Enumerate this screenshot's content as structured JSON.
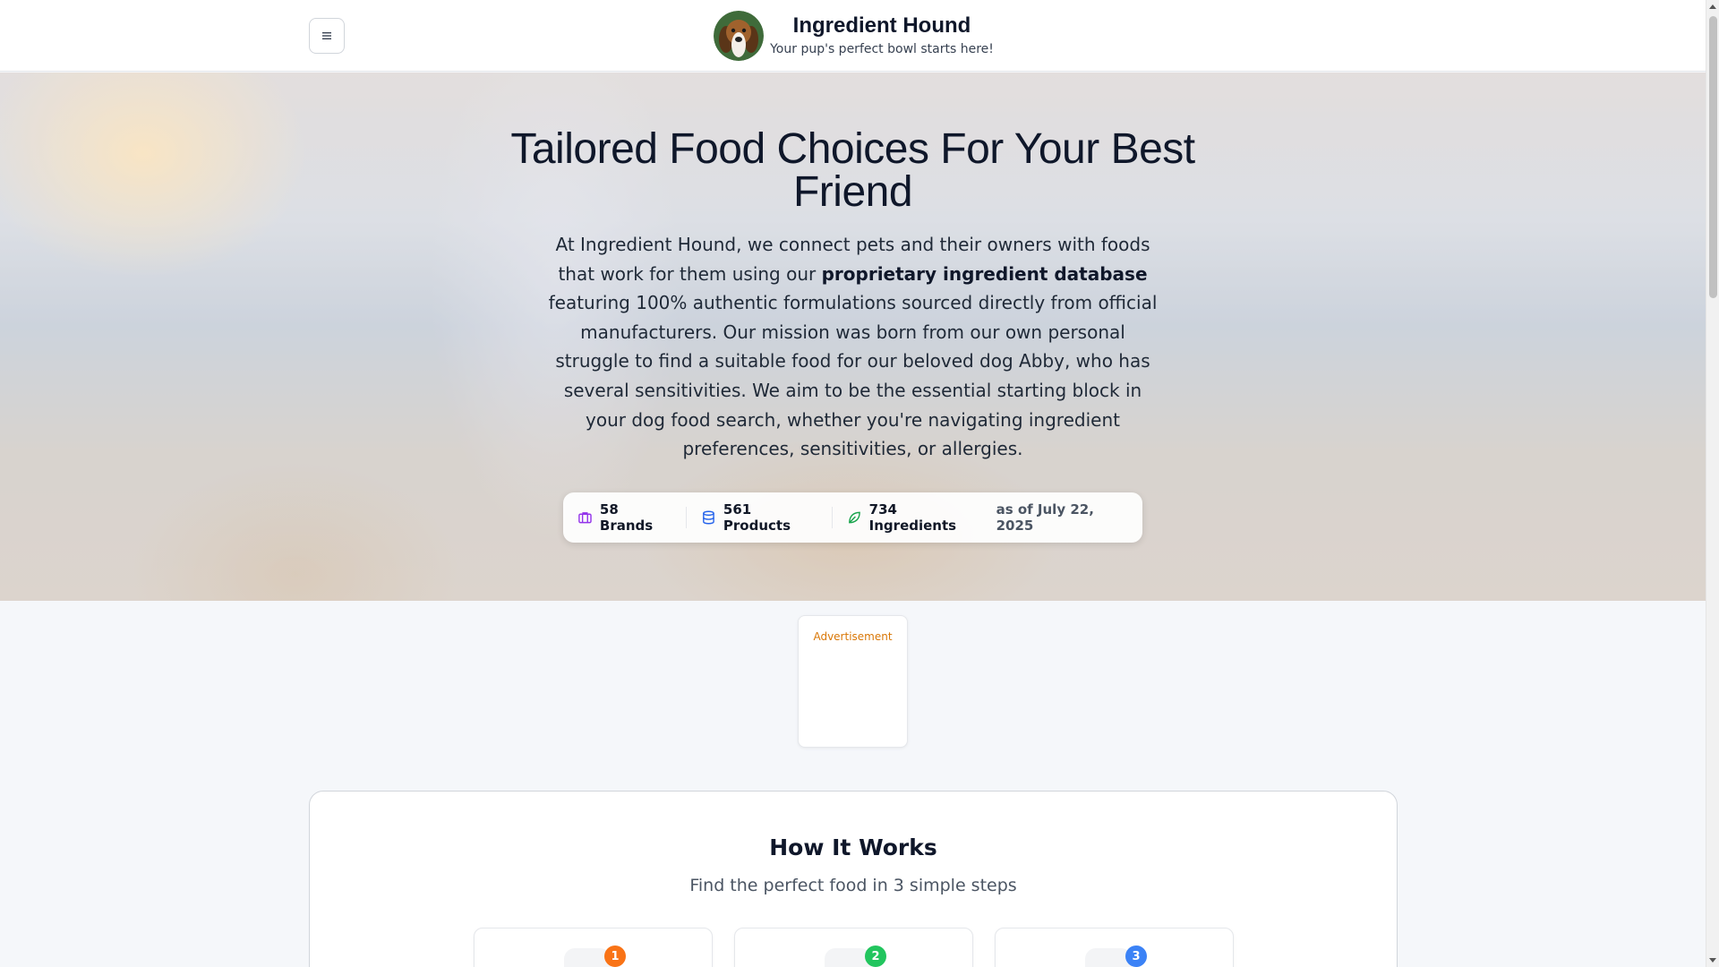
{
  "header": {
    "menu_icon": "hamburger-icon",
    "logo_icon": "beagle-dog-logo",
    "title": "Ingredient Hound",
    "tagline": "Your pup's perfect bowl starts here!"
  },
  "hero": {
    "title": "Tailored Food Choices For Your Best Friend",
    "desc_before": "At Ingredient Hound, we connect pets and their owners with foods that work for them using our ",
    "desc_bold": "proprietary ingredient database",
    "desc_after": " featuring 100% authentic formulations sourced directly from official manufacturers. Our mission was born from our own personal struggle to find a suitable food for our beloved dog Abby, who has several sensitivities. We aim to be the essential starting block in your dog food search, whether you're navigating ingredient preferences, sensitivities, or allergies."
  },
  "stats": {
    "brands": "58 Brands",
    "products": "561 Products",
    "ingredients": "734 Ingredients",
    "as_of": "as of July 22, 2025",
    "colors": {
      "brands": "#9333ea",
      "products": "#2563eb",
      "ingredients": "#16a34a"
    }
  },
  "ad": {
    "label": "Advertisement"
  },
  "how": {
    "title": "How It Works",
    "subtitle": "Find the perfect food in 3 simple steps",
    "steps": [
      {
        "num": "1",
        "color": "#f97316"
      },
      {
        "num": "2",
        "color": "#22c55e"
      },
      {
        "num": "3",
        "color": "#3b82f6"
      }
    ]
  }
}
